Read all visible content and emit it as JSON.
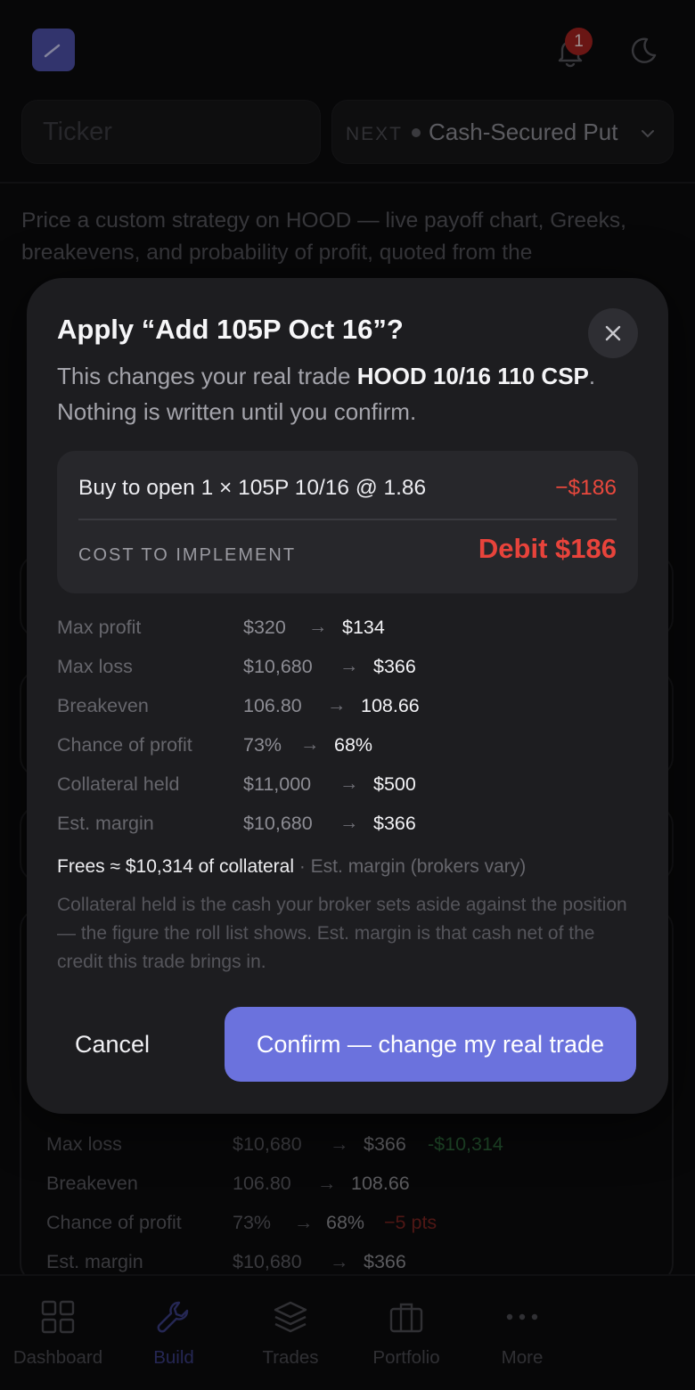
{
  "header": {
    "notification_count": "1",
    "ticker_placeholder": "Ticker",
    "next_label": "NEXT",
    "strategy_value": "Cash-Secured Put"
  },
  "intro_text": "Price a custom strategy on HOOD — live payoff chart, Greeks, breakevens, and probability of profit, quoted from the",
  "background_table": [
    {
      "label": "Max loss",
      "before": "$10,680",
      "after": "$366",
      "delta": "-$10,314",
      "delta_tone": "good"
    },
    {
      "label": "Breakeven",
      "before": "106.80",
      "after": "108.66",
      "delta": "",
      "delta_tone": ""
    },
    {
      "label": "Chance of profit",
      "before": "73%",
      "after": "68%",
      "delta": "−5 pts",
      "delta_tone": "bad"
    },
    {
      "label": "Est. margin",
      "before": "$10,680",
      "after": "$366",
      "delta": "",
      "delta_tone": ""
    }
  ],
  "modal": {
    "title": "Apply “Add 105P Oct 16”?",
    "desc_prefix": "This changes your real trade ",
    "desc_trade": "HOOD 10/16 110 CSP",
    "desc_suffix": ". Nothing is written until you confirm.",
    "leg_description": "Buy to open 1 × 105P 10/16 @ 1.86",
    "leg_cost": "−$186",
    "cost_label": "COST TO IMPLEMENT",
    "cost_value": "Debit $186",
    "metrics": [
      {
        "label": "Max profit",
        "before": "$320",
        "after": "$134"
      },
      {
        "label": "Max loss",
        "before": "$10,680",
        "after": "$366"
      },
      {
        "label": "Breakeven",
        "before": "106.80",
        "after": "108.66"
      },
      {
        "label": "Chance of profit",
        "before": "73%",
        "after": "68%"
      },
      {
        "label": "Collateral held",
        "before": "$11,000",
        "after": "$500"
      },
      {
        "label": "Est. margin",
        "before": "$10,680",
        "after": "$366"
      }
    ],
    "frees_text": "Frees ≈ $10,314 of collateral",
    "frees_note": " · Est. margin (brokers vary)",
    "footnote": "Collateral held is the cash your broker sets aside against the position — the figure the roll list shows. Est. margin is that cash net of the credit this trade brings in.",
    "cancel_label": "Cancel",
    "confirm_label": "Confirm — change my real trade"
  },
  "bottom_nav": [
    {
      "label": "Dashboard",
      "icon": "dashboard-icon",
      "active": false
    },
    {
      "label": "Build",
      "icon": "wrench-icon",
      "active": true
    },
    {
      "label": "Trades",
      "icon": "layers-icon",
      "active": false
    },
    {
      "label": "Portfolio",
      "icon": "briefcase-icon",
      "active": false
    },
    {
      "label": "More",
      "icon": "more-icon",
      "active": false
    }
  ],
  "colors": {
    "accent": "#6b72dd",
    "danger": "#e8433b",
    "positive": "#2f9e4a"
  }
}
